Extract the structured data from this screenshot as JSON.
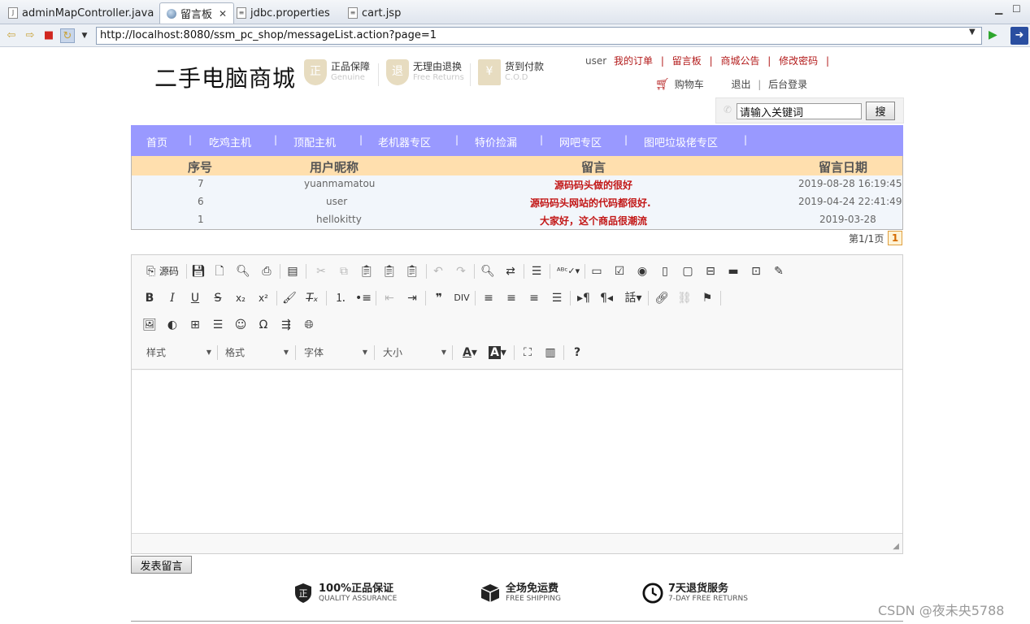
{
  "tabs": [
    {
      "label": "adminMapController.java",
      "icon": "java-file-icon"
    },
    {
      "label": "留言板",
      "icon": "globe-icon",
      "active": true
    },
    {
      "label": "jdbc.properties",
      "icon": "properties-file-icon"
    },
    {
      "label": "cart.jsp",
      "icon": "jsp-file-icon"
    }
  ],
  "browser": {
    "url": "http://localhost:8080/ssm_pc_shop/messageList.action?page=1"
  },
  "header": {
    "logo": "二手电脑商城",
    "badges": [
      {
        "glyph": "正",
        "title": "正品保障",
        "sub": "Genuine"
      },
      {
        "glyph": "退",
        "title": "无理由退换",
        "sub": "Free Returns"
      },
      {
        "glyph": "¥",
        "title": "货到付款",
        "sub": "C.O.D"
      }
    ],
    "user": "user",
    "links": [
      "我的订单",
      "留言板",
      "商城公告",
      "修改密码"
    ],
    "cart": "购物车",
    "logout": "退出",
    "admin": "后台登录",
    "search_placeholder": "请输入关键词",
    "search_button": "搜"
  },
  "nav": {
    "items": [
      "首页",
      "吃鸡主机",
      "顶配主机",
      "老机器专区",
      "特价捡漏",
      "网吧专区",
      "图吧垃圾佬专区"
    ]
  },
  "messages": {
    "headers": [
      "序号",
      "用户昵称",
      "留言",
      "留言日期"
    ],
    "rows": [
      {
        "id": "7",
        "user": "yuanmamatou",
        "msg": "源码码头做的很好",
        "date": "2019-08-28 16:19:45"
      },
      {
        "id": "6",
        "user": "user",
        "msg": "源码码头网站的代码都很好.",
        "date": "2019-04-24 22:41:49"
      },
      {
        "id": "1",
        "user": "hellokitty",
        "msg": "大家好，这个商品很潮流",
        "date": "2019-03-28"
      }
    ]
  },
  "pager": {
    "text": "第1/1页",
    "current": "1"
  },
  "editor": {
    "source_label": "源码",
    "combos": [
      "样式",
      "格式",
      "字体",
      "大小"
    ],
    "submit": "发表留言"
  },
  "services": [
    {
      "title": "100%正品保证",
      "sub": "QUALITY ASSURANCE",
      "glyph": "正"
    },
    {
      "title": "全场免运费",
      "sub": "FREE SHIPPING",
      "glyph": "box"
    },
    {
      "title": "7天退货服务",
      "sub": "7-DAY FREE RETURNS",
      "glyph": "clock"
    }
  ],
  "watermark": "CSDN @夜未央5788",
  "colors": {
    "nav": "#9999ff",
    "table_head": "#ffdfae",
    "accent_red": "#c21616"
  }
}
